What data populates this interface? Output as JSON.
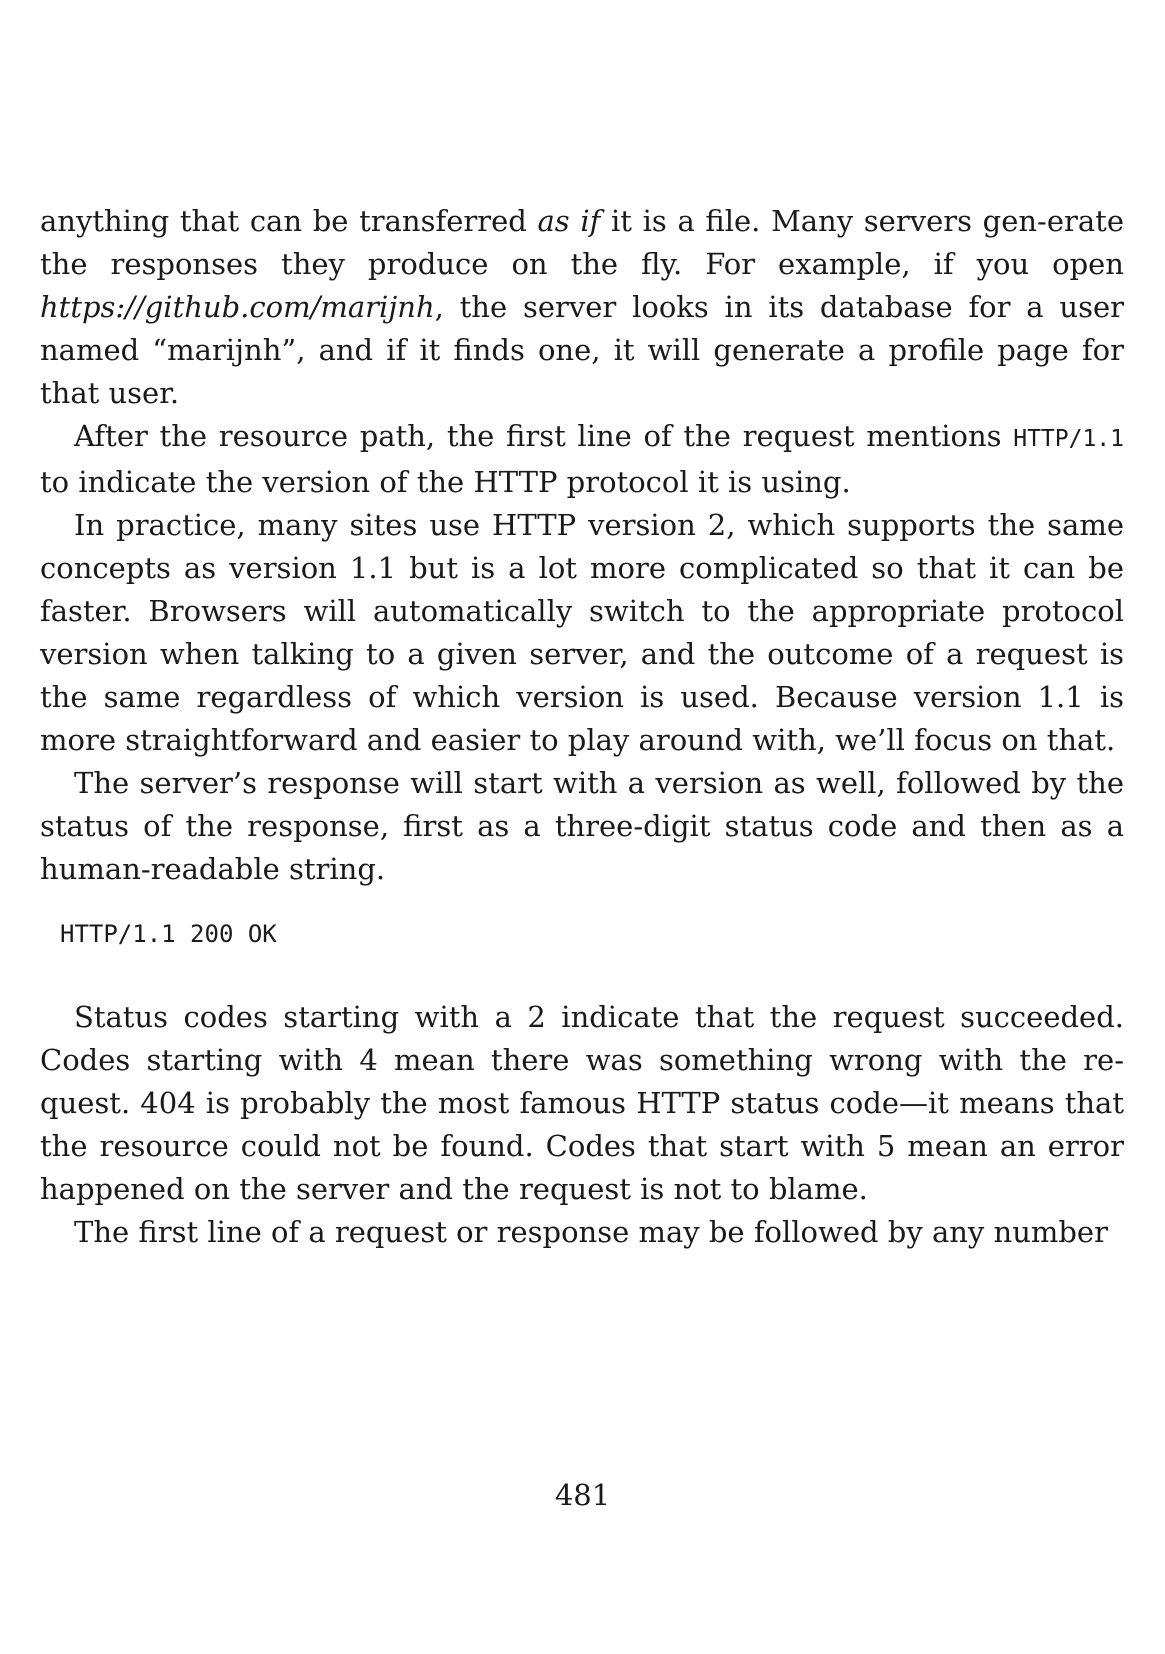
{
  "paragraphs": {
    "p1": {
      "a": "anything that can be transferred ",
      "em1": "as if",
      "b": " it is a file. Many servers gen-erate the responses they produce on the fly. For example, if you open ",
      "em2": "https://github.com/marijnh",
      "c": ", the server looks in its database for a user named “marijnh”, and if it finds one, it will generate a profile page for that user."
    },
    "p2": {
      "a": "After the resource path, the first line of the request mentions ",
      "code": "HTTP/1.1",
      "b": " to indicate the version of the HTTP protocol it is using."
    },
    "p3": "In practice, many sites use HTTP version 2, which supports the same concepts as version 1.1 but is a lot more complicated so that it can be faster. Browsers will automatically switch to the appropriate protocol version when talking to a given server, and the outcome of a request is the same regardless of which version is used. Because version 1.1 is more straightforward and easier to play around with, we’ll focus on that.",
    "p4": "The server’s response will start with a version as well, followed by the status of the response, first as a three-digit status code and then as a human-readable string.",
    "code_block": "HTTP/1.1 200 OK",
    "p5": "Status codes starting with a 2 indicate that the request succeeded. Codes starting with 4 mean there was something wrong with the re-quest. 404 is probably the most famous HTTP status code—it means that the resource could not be found. Codes that start with 5 mean an error happened on the server and the request is not to blame.",
    "p6": "The first line of a request or response may be followed by any number"
  },
  "page_number": "481"
}
